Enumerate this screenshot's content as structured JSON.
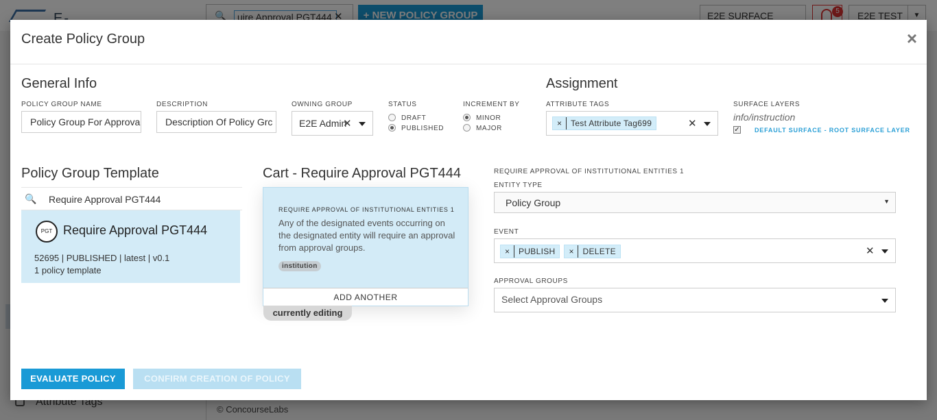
{
  "background": {
    "logo_text": "E-ORCHESTR",
    "search_value": "uire Approval PGT444",
    "new_button": "+ NEW POLICY GROUP",
    "surface": "E2E SURFACE",
    "notification_count": "5",
    "user": "E2E TEST",
    "sidebar_item": "Attribute Tags",
    "footer": "© ConcourseLabs"
  },
  "modal": {
    "title": "Create Policy Group",
    "close": "×",
    "general_info": {
      "title": "General Info",
      "policy_group_name_label": "POLICY GROUP NAME",
      "policy_group_name_value": "Policy Group For Approva",
      "description_label": "DESCRIPTION",
      "description_value": "Description Of Policy Grc",
      "owning_group_label": "OWNING GROUP",
      "owning_group_value": "E2E Admin",
      "status_label": "STATUS",
      "status_options": [
        "DRAFT",
        "PUBLISHED"
      ],
      "status_selected": "PUBLISHED",
      "increment_label": "INCREMENT BY",
      "increment_options": [
        "MINOR",
        "MAJOR"
      ],
      "increment_selected": "MINOR"
    },
    "assignment": {
      "title": "Assignment",
      "attribute_tags_label": "ATTRIBUTE TAGS",
      "attribute_tags": [
        "Test Attribute Tag699"
      ],
      "surface_layers_label": "SURFACE LAYERS",
      "surface_layers_hint": "info/instruction",
      "surface_layer_item": "DEFAULT SURFACE - ROOT SURFACE LAYER",
      "surface_layer_checked": true
    },
    "template": {
      "title": "Policy Group Template",
      "search_value": "Require Approval PGT444",
      "card_logo": "PGT",
      "card_name": "Require Approval PGT444",
      "card_meta": "52695 | PUBLISHED | latest | v0.1",
      "card_count": "1 policy template"
    },
    "cart": {
      "title": "Cart - Require Approval PGT444",
      "item_title": "REQUIRE APPROVAL OF INSTITUTIONAL ENTITIES 1",
      "item_description": "Any of the designated events occurring on the designated entity will require an approval from approval groups.",
      "item_chip": "institution",
      "add_another": "ADD ANOTHER",
      "editing": "currently editing"
    },
    "config": {
      "heading": "REQUIRE APPROVAL OF INSTITUTIONAL ENTITIES 1",
      "entity_type_label": "ENTITY TYPE",
      "entity_type_value": "Policy Group",
      "event_label": "EVENT",
      "events": [
        "PUBLISH",
        "DELETE"
      ],
      "approval_groups_label": "APPROVAL GROUPS",
      "approval_groups_placeholder": "Select Approval Groups"
    },
    "buttons": {
      "evaluate": "EVALUATE POLICY",
      "confirm": "CONFIRM CREATION OF POLICY"
    },
    "colors": {
      "primary": "#1a9ad6",
      "primary_disabled": "#b9dff2",
      "selected_bg": "#d3ebf7",
      "link": "#2a9fd6"
    }
  }
}
